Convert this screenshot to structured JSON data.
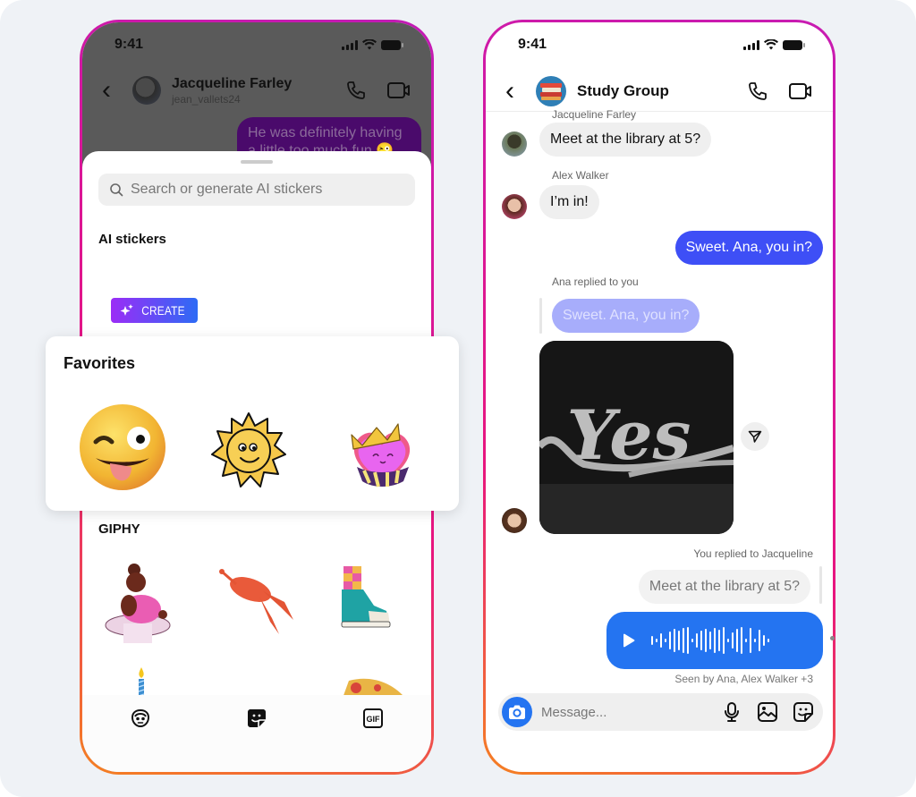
{
  "left_phone": {
    "status_time": "9:41",
    "header": {
      "back_label": "‹",
      "contact_name": "Jacqueline Farley",
      "username": "jean_vallets24"
    },
    "background_message": "He was definitely having a little too much fun 😜",
    "sticker_sheet": {
      "search_placeholder": "Search or generate AI stickers",
      "ai_section_title": "AI stickers",
      "create_label": "CREATE",
      "giphy_section_title": "GIPHY",
      "giphy_items": [
        "dancing-ballerina-sticker",
        "lobster-sticker",
        "sneaker-sticker",
        "birthday-candle-sticker",
        "sticker",
        "pizza-slice-sticker"
      ],
      "bottom_tabs": [
        {
          "name": "avatar-tab",
          "icon": "avatar-icon"
        },
        {
          "name": "stickers-tab",
          "icon": "sticker-icon"
        },
        {
          "name": "gif-tab",
          "icon": "gif-icon",
          "label": "GIF"
        }
      ]
    }
  },
  "favorites": {
    "title": "Favorites",
    "stickers": [
      "winking-tongue-emoji",
      "smiling-sun-sticker",
      "crowned-heart-sticker"
    ]
  },
  "right_phone": {
    "status_time": "9:41",
    "header": {
      "back_label": "‹",
      "group_name": "Study Group"
    },
    "messages": [
      {
        "sender": "Jacqueline Farley",
        "text": "Meet at the library at 5?",
        "direction": "in"
      },
      {
        "sender": "Alex Walker",
        "text": "I’m in!",
        "direction": "in"
      },
      {
        "text": "Sweet. Ana, you in?",
        "direction": "out"
      },
      {
        "reply_label": "Ana replied to you",
        "quoted": "Sweet. Ana, you in?",
        "attachment": "Yes photo",
        "direction": "in"
      },
      {
        "reply_label": "You replied to Jacqueline",
        "quoted": "Meet at the library at 5?",
        "attachment": "voice message",
        "direction": "out"
      }
    ],
    "seen_label": "Seen by Ana, Alex Walker +3",
    "composer_placeholder": "Message...",
    "colors": {
      "outgoing_bubble": "#3e4ff6",
      "voice_bubble": "#2474f1",
      "incoming_bubble": "#efefef"
    }
  }
}
